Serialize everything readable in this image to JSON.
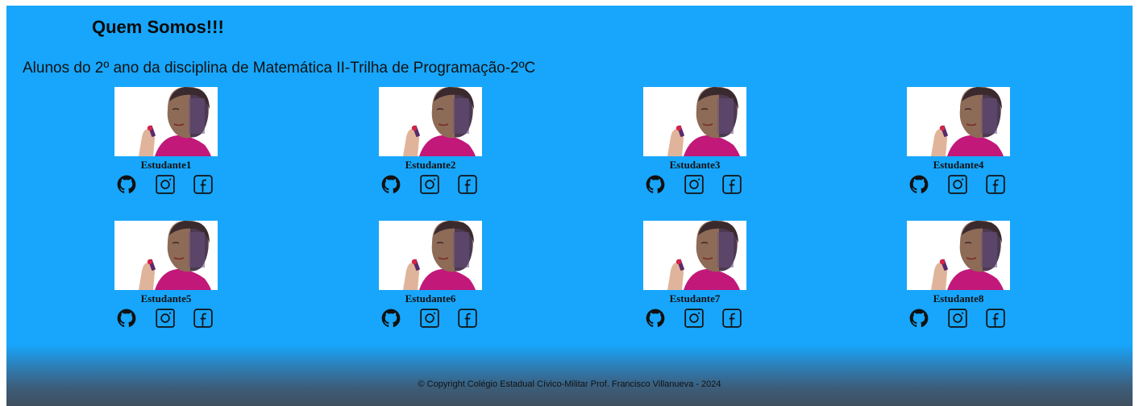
{
  "header": {
    "title": "Quem Somos!!!",
    "subtitle": "Alunos do 2º ano da disciplina de Matemática II-Trilha de Programação-2ºC"
  },
  "students": [
    {
      "name": "Estudante1"
    },
    {
      "name": "Estudante2"
    },
    {
      "name": "Estudante3"
    },
    {
      "name": "Estudante4"
    },
    {
      "name": "Estudante5"
    },
    {
      "name": "Estudante6"
    },
    {
      "name": "Estudante7"
    },
    {
      "name": "Estudante8"
    }
  ],
  "social_icons": [
    "github-icon",
    "instagram-icon",
    "facebook-icon"
  ],
  "footer": {
    "copyright": "© Copyright Colégio Estadual Cívico-Militar Prof. Francisco Villanueva - 2024"
  },
  "colors": {
    "background": "#17a6fb",
    "footer_dark": "#3f4f5e"
  }
}
